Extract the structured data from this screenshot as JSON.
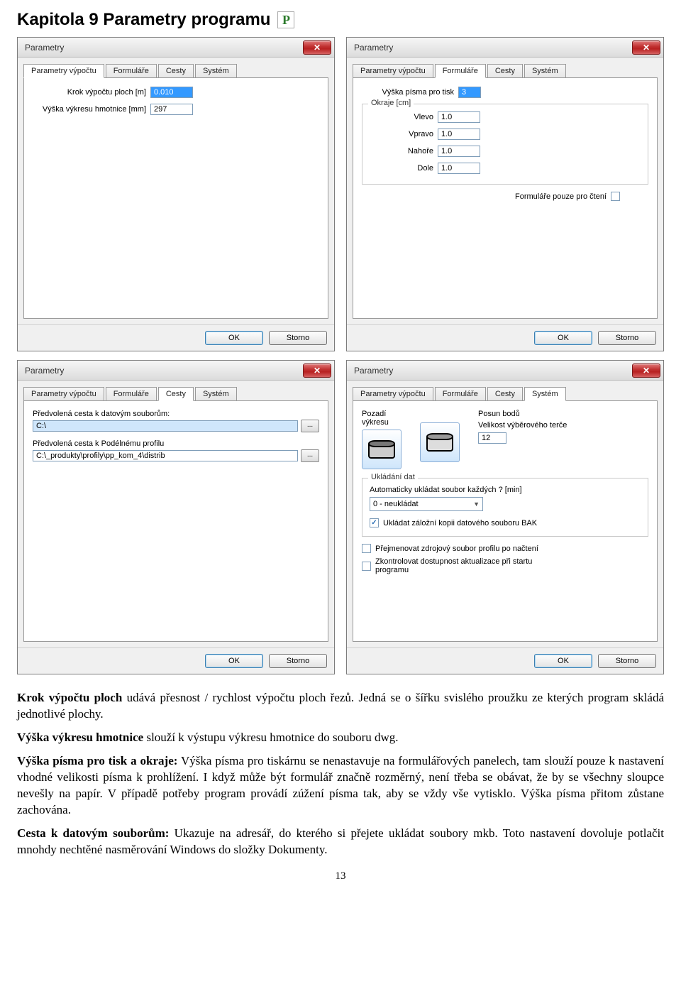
{
  "heading": "Kapitola 9  Parametry programu",
  "window_title": "Parametry",
  "tabs": {
    "calc": "Parametry výpočtu",
    "forms": "Formuláře",
    "paths": "Cesty",
    "system": "Systém"
  },
  "ok": "OK",
  "cancel": "Storno",
  "close_glyph": "✕",
  "calc": {
    "step_label": "Krok výpočtu ploch [m]",
    "step_value": "0.010",
    "height_label": "Výška výkresu hmotnice [mm]",
    "height_value": "297"
  },
  "forms": {
    "font_label": "Výška písma pro tisk",
    "font_value": "3",
    "margins_legend": "Okraje [cm]",
    "left_l": "Vlevo",
    "left_v": "1.0",
    "right_l": "Vpravo",
    "right_v": "1.0",
    "top_l": "Nahoře",
    "top_v": "1.0",
    "bottom_l": "Dole",
    "bottom_v": "1.0",
    "readonly_l": "Formuláře pouze pro čtení"
  },
  "paths": {
    "data_l": "Předvolená cesta k datovým souborům:",
    "data_v": "C:\\",
    "profile_l": "Předvolená cesta k Podélnému profilu",
    "profile_v": "C:\\_produkty\\profily\\pp_kom_4\\distrib",
    "browse": "..."
  },
  "system": {
    "bg_l": "Pozadí výkresu",
    "move_l": "Posun bodů",
    "target_l": "Velikost výběrového terče",
    "target_v": "12",
    "save_legend": "Ukládání dat",
    "auto_l": "Automaticky ukládat soubor každých ? [min]",
    "auto_v": "0 - neukládat",
    "bak_l": "Ukládat záložní kopii datového souboru BAK",
    "rename_l": "Přejmenovat zdrojový soubor profilu po načtení",
    "update_l": "Zkontrolovat dostupnost aktualizace při startu programu"
  },
  "prose": {
    "p1a": "Krok výpočtu ploch",
    "p1b": " udává přesnost / rychlost výpočtu ploch řezů. Jedná se o šířku svislého proužku ze kterých program skládá jednotlivé plochy.",
    "p2a": "Výška výkresu hmotnice",
    "p2b": " slouží k výstupu výkresu hmotnice do souboru dwg.",
    "p3a": "Výška písma pro tisk a okraje:",
    "p3b": " Výška písma pro tiskárnu se nenastavuje na formulářových panelech, tam slouží pouze k nastavení vhodné velikosti písma k prohlížení. I když může být formulář značně rozměrný, není třeba se obávat, že by se všechny sloupce nevešly na papír. V případě potřeby program provádí zúžení písma tak, aby se vždy vše vytisklo. Výška písma přitom zůstane zachována.",
    "p4a": "Cesta k datovým souborům:",
    "p4b": " Ukazuje na adresář, do kterého si přejete ukládat soubory mkb. Toto nastavení dovoluje potlačit mnohdy nechtěné nasměrování Windows do složky Dokumenty."
  },
  "page_number": "13"
}
